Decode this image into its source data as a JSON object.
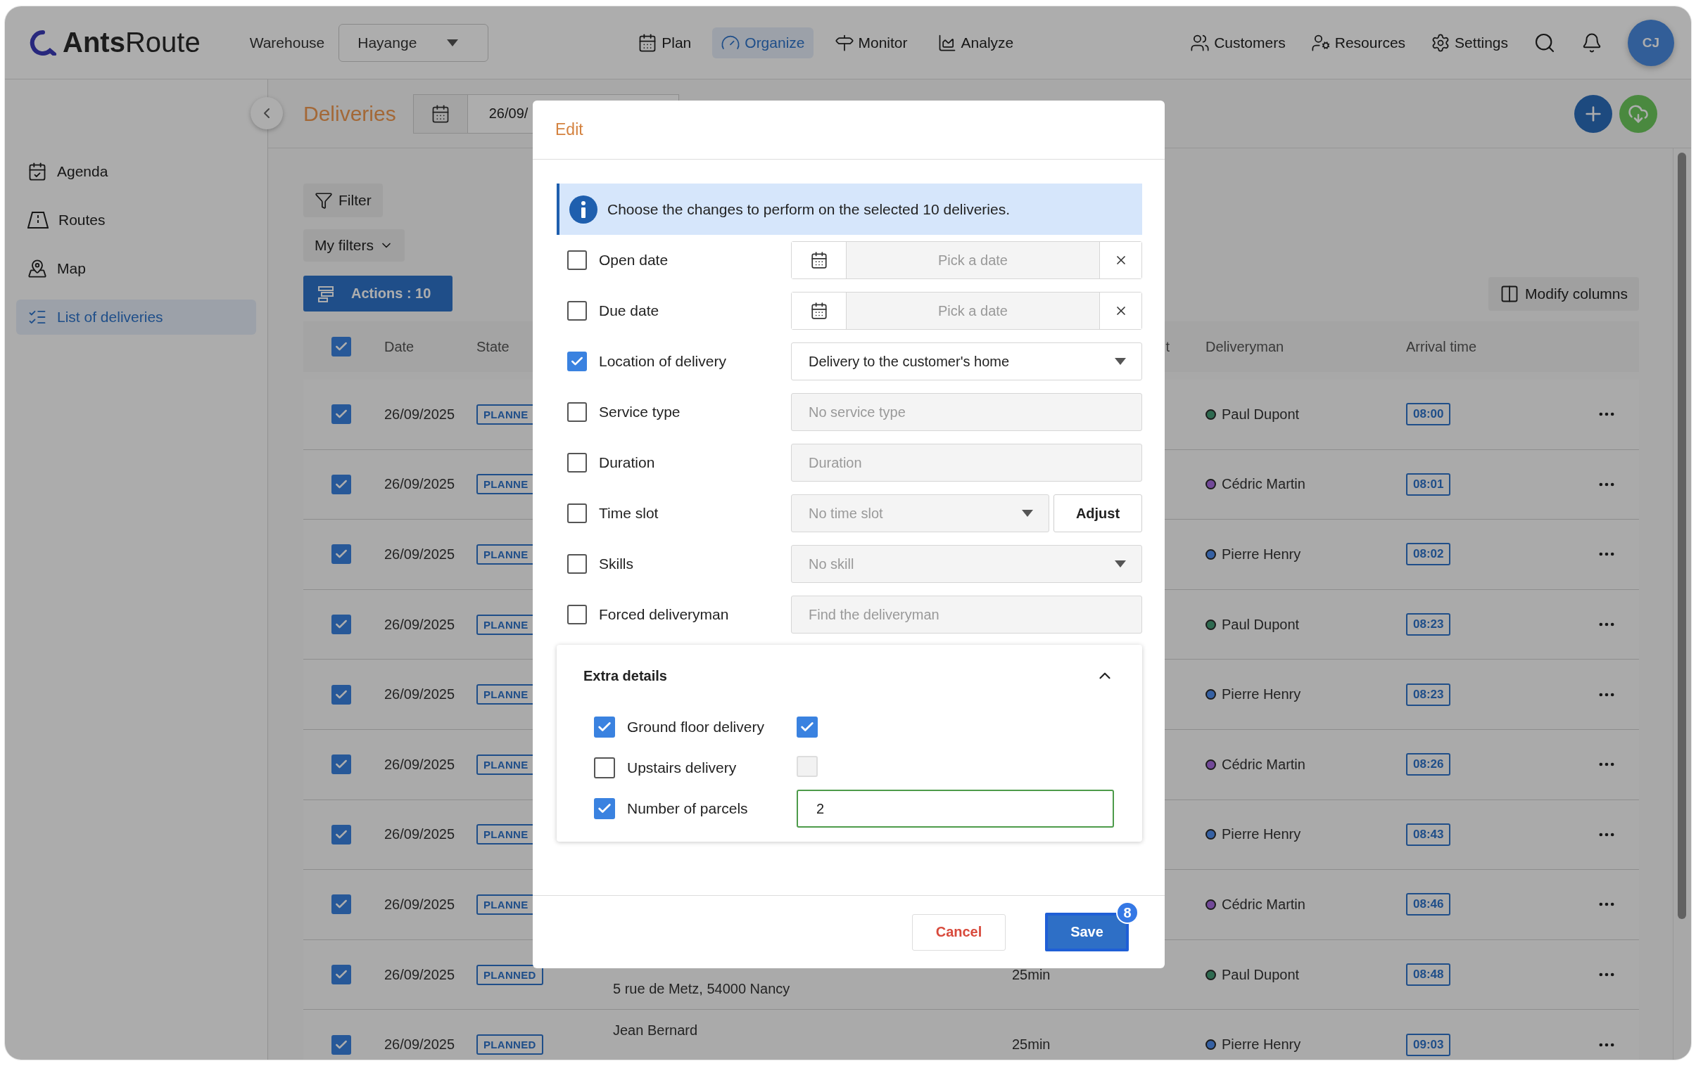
{
  "topbar": {
    "logo": "**Ants**Route",
    "warehouse_label": "Warehouse",
    "warehouse": "Hayange",
    "nav": [
      {
        "label": "Plan",
        "selected": false
      },
      {
        "label": "Organize",
        "selected": true
      },
      {
        "label": "Monitor",
        "selected": false
      },
      {
        "label": "Analyze",
        "selected": false
      }
    ],
    "right_nav": [
      {
        "label": "Customers"
      },
      {
        "label": "Resources"
      },
      {
        "label": "Settings"
      }
    ],
    "avatar": "CJ"
  },
  "sidebar": {
    "items": [
      {
        "label": "Agenda",
        "selected": false
      },
      {
        "label": "Routes",
        "selected": false
      },
      {
        "label": "Map",
        "selected": false
      },
      {
        "label": "List of deliveries",
        "selected": true
      }
    ]
  },
  "page": {
    "title": "Deliveries",
    "date": "26/09/",
    "filter_button": "Filter",
    "my_filters": "My filters",
    "actions_button": "Actions : 10",
    "modify_columns": "Modify columns"
  },
  "table": {
    "all_selected": true,
    "columns": [
      "Date",
      "State",
      "t",
      "Deliveryman",
      "Arrival time"
    ],
    "rows": [
      {
        "checked": true,
        "date": "26/09/2025",
        "state": "PLANNE",
        "deliveryman": "Paul Dupont",
        "color": "#2f6a50",
        "arrival": "08:00"
      },
      {
        "checked": true,
        "date": "26/09/2025",
        "state": "PLANNE",
        "deliveryman": "Cédric Martin",
        "color": "#724998",
        "arrival": "08:01"
      },
      {
        "checked": true,
        "date": "26/09/2025",
        "state": "PLANNE",
        "deliveryman": "Pierre Henry",
        "color": "#3661a3",
        "arrival": "08:02"
      },
      {
        "checked": true,
        "date": "26/09/2025",
        "state": "PLANNE",
        "deliveryman": "Paul Dupont",
        "color": "#2f6a50",
        "arrival": "08:23"
      },
      {
        "checked": true,
        "date": "26/09/2025",
        "state": "PLANNE",
        "deliveryman": "Pierre Henry",
        "color": "#3661a3",
        "arrival": "08:23"
      },
      {
        "checked": true,
        "date": "26/09/2025",
        "state": "PLANNE",
        "deliveryman": "Cédric Martin",
        "color": "#724998",
        "arrival": "08:26"
      },
      {
        "checked": true,
        "date": "26/09/2025",
        "state": "PLANNE",
        "deliveryman": "Pierre Henry",
        "color": "#3661a3",
        "arrival": "08:43"
      },
      {
        "checked": true,
        "date": "26/09/2025",
        "state": "PLANNE",
        "deliveryman": "Cédric Martin",
        "color": "#724998",
        "arrival": "08:46"
      },
      {
        "checked": true,
        "date": "26/09/2025",
        "state": "PLANNED",
        "address": "5 rue de Metz, 54000 Nancy",
        "duration": "25min",
        "deliveryman": "Paul Dupont",
        "color": "#2f6a50",
        "arrival": "08:48"
      },
      {
        "checked": true,
        "date": "26/09/2025",
        "state": "PLANNED",
        "customer": "Jean Bernard",
        "duration": "25min",
        "deliveryman": "Pierre Henry",
        "color": "#3661a3",
        "arrival": "09:03"
      }
    ]
  },
  "modal": {
    "title": "Edit",
    "info": "Choose the changes to perform on the selected 10 deliveries.",
    "fields": [
      {
        "kind": "date",
        "label": "Open date",
        "checked": false,
        "placeholder": "Pick a date"
      },
      {
        "kind": "date",
        "label": "Due date",
        "checked": false,
        "placeholder": "Pick a date"
      },
      {
        "kind": "select",
        "label": "Location of delivery",
        "checked": true,
        "value": "Delivery to the customer's home"
      },
      {
        "kind": "text",
        "label": "Service type",
        "checked": false,
        "placeholder": "No service type"
      },
      {
        "kind": "text",
        "label": "Duration",
        "checked": false,
        "placeholder": "Duration"
      },
      {
        "kind": "select",
        "label": "Time slot",
        "checked": false,
        "placeholder": "No time slot",
        "button": "Adjust"
      },
      {
        "kind": "select",
        "label": "Skills",
        "checked": false,
        "placeholder": "No skill"
      },
      {
        "kind": "text",
        "label": "Forced deliveryman",
        "checked": false,
        "placeholder": "Find the deliveryman"
      }
    ],
    "extra": {
      "title": "Extra details",
      "expanded": true,
      "fields": [
        {
          "kind": "toggle",
          "label": "Ground floor delivery",
          "checked": true,
          "value_checked": true
        },
        {
          "kind": "toggle",
          "label": "Upstairs delivery",
          "checked": false,
          "value_checked": false
        },
        {
          "kind": "number",
          "label": "Number of parcels",
          "checked": true,
          "value": "2"
        }
      ]
    },
    "cancel": "Cancel",
    "save": "Save",
    "save_badge": "8"
  }
}
